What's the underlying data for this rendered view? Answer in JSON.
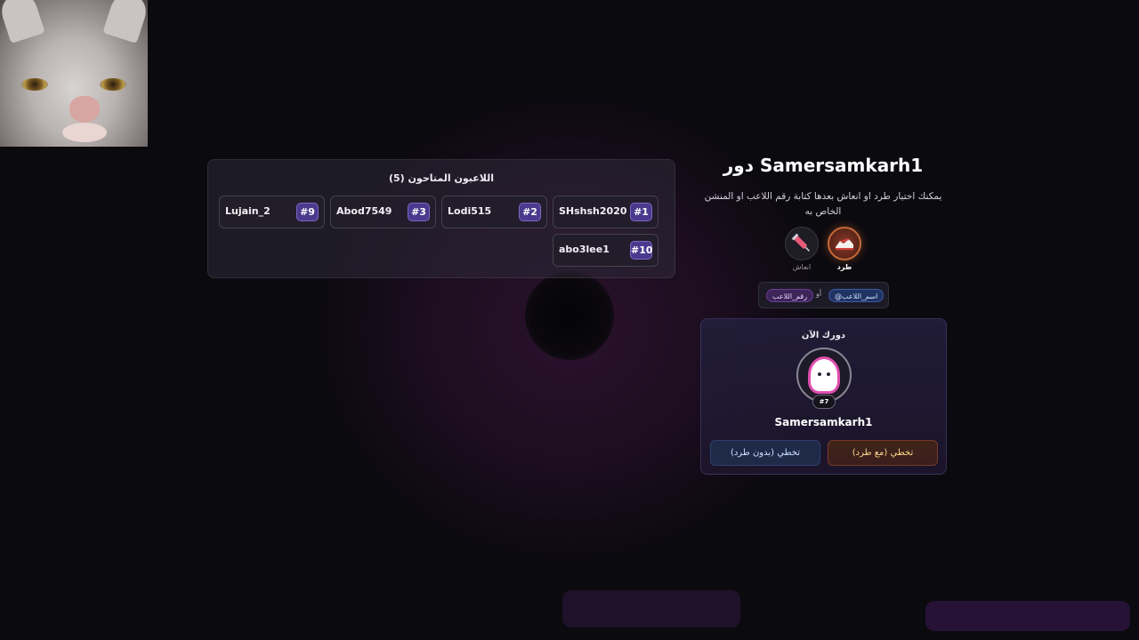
{
  "players_panel": {
    "title": "اللاعبون المتاحون (5)",
    "players": [
      {
        "num": "#1",
        "name": "SHshsh2020"
      },
      {
        "num": "#2",
        "name": "Lodi515"
      },
      {
        "num": "#3",
        "name": "Abod7549"
      },
      {
        "num": "#9",
        "name": "Lujain_2"
      },
      {
        "num": "#10",
        "name": "abo3lee1"
      }
    ]
  },
  "turn": {
    "title": "دور Samersamkarh1",
    "description": "يمكنك اختيار طرد او انعاش بعدها كتابة رقم اللاعب او المنشن الخاص به"
  },
  "actions": {
    "kick_label": "طرد",
    "revive_label": "انعاش"
  },
  "hint": {
    "name_chip": "@اسم_اللاعب",
    "or": "أو",
    "number_chip": "رقم_اللاعب"
  },
  "current": {
    "label": "دورك الآن",
    "badge": "#7",
    "name": "Samersamkarh1",
    "skip_with_kick": "تخطي (مع طرد)",
    "skip_without_kick": "تخطي (بدون طرد)"
  },
  "colors": {
    "accent_purple": "#4a3a8e",
    "kick_orange": "#c56a3a",
    "name_chip_blue": "#213363",
    "number_chip_purple": "#3e2559"
  },
  "icons": {
    "kick": "sneaker-icon",
    "revive": "syringe-icon",
    "avatar": "ghost-avatar-icon"
  }
}
